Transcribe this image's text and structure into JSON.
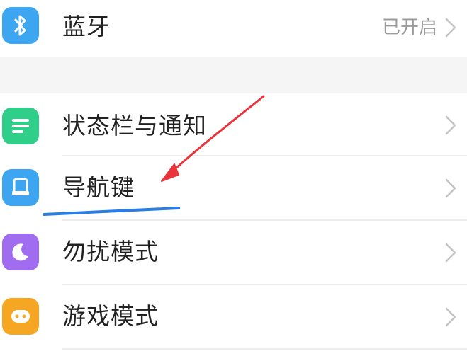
{
  "settings": {
    "bluetooth": {
      "label": "蓝牙",
      "value": "已开启",
      "icon": "bluetooth-icon",
      "icon_color": "#3ea6f0"
    },
    "items": [
      {
        "label": "状态栏与通知",
        "icon": "status-bar-icon",
        "icon_color": "#2fcf8a"
      },
      {
        "label": "导航键",
        "icon": "navigation-key-icon",
        "icon_color": "#3ea6f0"
      },
      {
        "label": "勿扰模式",
        "icon": "do-not-disturb-icon",
        "icon_color": "#a06cf0"
      },
      {
        "label": "游戏模式",
        "icon": "game-mode-icon",
        "icon_color": "#f5a623"
      }
    ]
  },
  "annotation": {
    "arrow_color": "#e8343a",
    "underline_color": "#2a7de1"
  }
}
